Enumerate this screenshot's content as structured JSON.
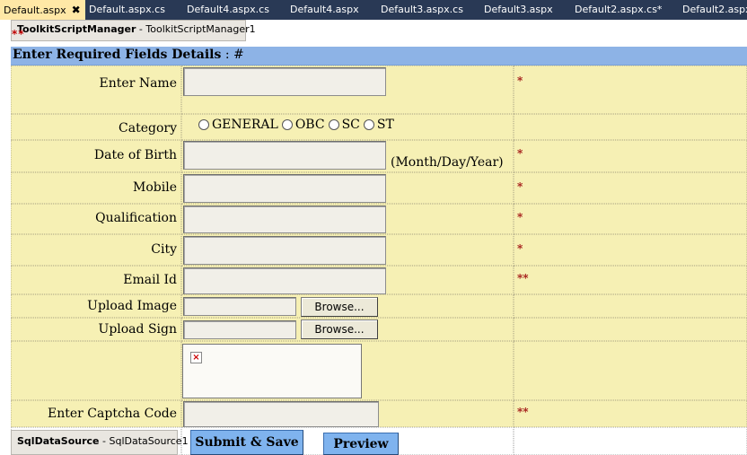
{
  "tabs": [
    {
      "label": "Default.aspx",
      "active": true
    },
    {
      "label": "Default.aspx.cs"
    },
    {
      "label": "Default4.aspx.cs"
    },
    {
      "label": "Default4.aspx"
    },
    {
      "label": "Default3.aspx.cs"
    },
    {
      "label": "Default3.aspx"
    },
    {
      "label": "Default2.aspx.cs*"
    },
    {
      "label": "Default2.aspx"
    }
  ],
  "close_glyph": "✖",
  "script_manager": {
    "type": "ToolkitScriptManager",
    "id": "ToolkitScriptManager1"
  },
  "required_marker_top": "**",
  "form": {
    "heading": "Enter Required Fields Details",
    "heading_suffix": " : #",
    "name_label": "Enter Name",
    "name_star": "*",
    "category_label": "Category",
    "category_options": [
      "GENERAL",
      "OBC",
      "SC",
      "ST"
    ],
    "dob_label": "Date of Birth",
    "dob_note": "(Month/Day/Year)",
    "dob_star": "*",
    "mobile_label": "Mobile",
    "mobile_star": "*",
    "qualification_label": "Qualification",
    "qualification_star": "*",
    "city_label": "City",
    "city_star": "*",
    "email_label": "Email Id",
    "email_star": "**",
    "upload_image_label": "Upload Image",
    "upload_sign_label": "Upload Sign",
    "browse_label": "Browse...",
    "captcha_label": "Enter Captcha Code",
    "captcha_star": "**",
    "broken_image_glyph": "×"
  },
  "datasource": {
    "type": "SqlDataSource",
    "id": "SqlDataSource1"
  },
  "separator": " - ",
  "buttons": {
    "submit": "Submit & Save",
    "preview": "Preview"
  },
  "colors": {
    "tabbar": "#293955",
    "active_tab": "#ffe8a6",
    "header_band": "#8db3e6",
    "row_bg": "#f6f0b4",
    "button_blue": "#7fb3ee",
    "star_red": "#a01010"
  }
}
